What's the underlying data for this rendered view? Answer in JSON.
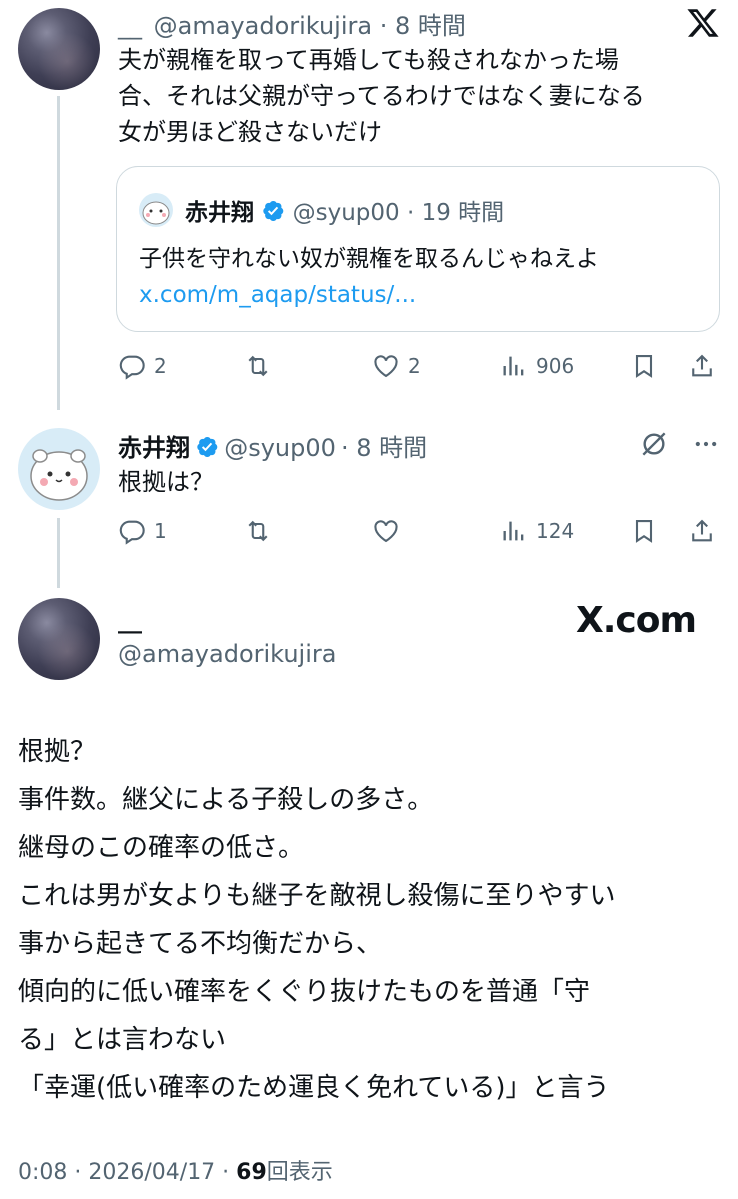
{
  "tweet1": {
    "display_name": "__",
    "handle": "@amayadorikujira",
    "time": "8 時間",
    "text_lines": [
      "夫が親権を取って再婚しても殺されなかった場",
      "合、それは父親が守ってるわけではなく妻になる",
      "女が男ほど殺さないだけ"
    ],
    "quote": {
      "display_name": "赤井翔",
      "handle": "@syup00",
      "time": "19 時間",
      "text": "子供を守れない奴が親権を取るんじゃねえよ",
      "link": "x.com/m_aqap/status/..."
    },
    "actions": {
      "replies": "2",
      "reposts": "",
      "likes": "2",
      "views": "906"
    }
  },
  "tweet2": {
    "display_name": "赤井翔",
    "handle": "@syup00",
    "time": "8 時間",
    "text": "根拠は？",
    "actions": {
      "replies": "1",
      "reposts": "",
      "likes": "",
      "views": "124"
    }
  },
  "main_tweet": {
    "display_name": "__",
    "handle": "@amayadorikujira",
    "brand": "X.com",
    "body_lines": [
      "根拠？",
      "事件数。継父による子殺しの多さ。",
      "継母のこの確率の低さ。",
      "これは男が女よりも継子を敵視し殺傷に至りやすい",
      "事から起きてる不均衡だから、",
      "傾向的に低い確率をくぐり抜けたものを普通「守",
      "る」とは言わない",
      "「幸運(低い確率のため運良く免れている)」と言う"
    ],
    "timestamp": "0:08 · 2026/04/17 · ",
    "view_count": "69",
    "view_label": "回表示"
  },
  "colors": {
    "text": "#0f1419",
    "muted": "#536471",
    "verified": "#1d9bf0",
    "border": "#cfd9de"
  },
  "icons": [
    "x-logo-icon",
    "verified-icon",
    "reply-icon",
    "repost-icon",
    "like-icon",
    "views-icon",
    "bookmark-icon",
    "share-icon",
    "grok-icon",
    "more-icon"
  ]
}
